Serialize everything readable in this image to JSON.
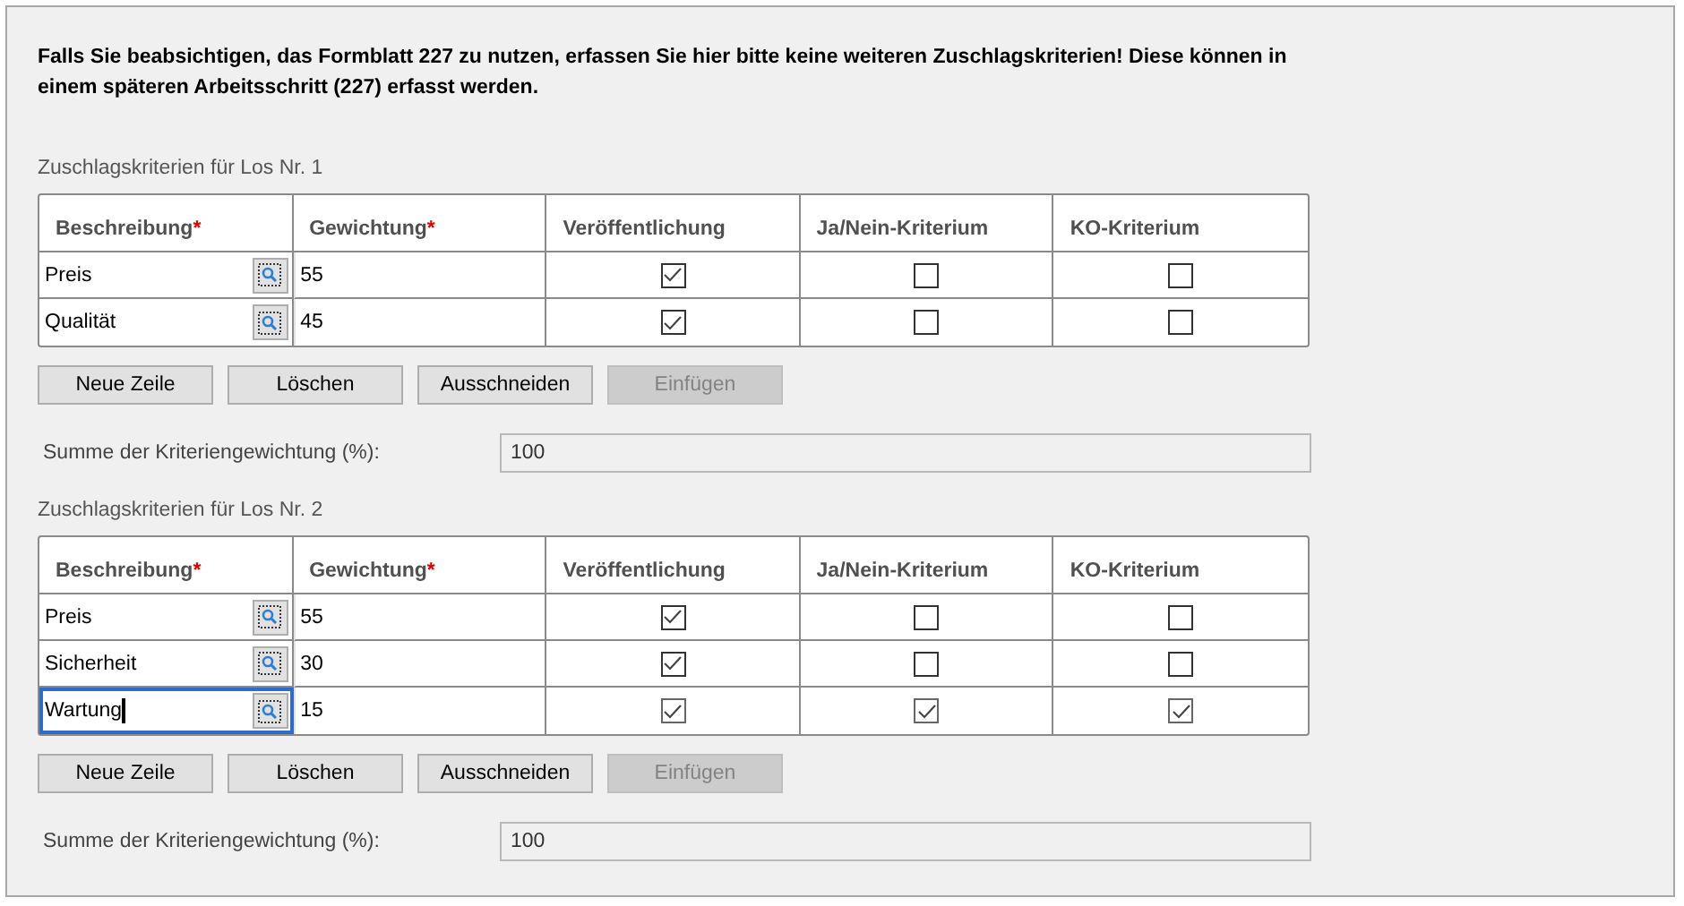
{
  "notice": "Falls Sie beabsichtigen, das Formblatt 227 zu nutzen, erfassen Sie hier bitte keine weiteren Zuschlagskriterien! Diese können in einem späteren Arbeitsschritt (227) erfasst werden.",
  "sections": [
    {
      "title": "Zuschlagskriterien für Los Nr. 1",
      "columns": [
        {
          "label": "Beschreibung",
          "marker": "*"
        },
        {
          "label": "Gewichtung",
          "marker": "*"
        },
        {
          "label": "Veröffentlichung"
        },
        {
          "label": "Ja/Nein-Kriterium"
        },
        {
          "label": "KO-Kriterium"
        }
      ],
      "rows": [
        {
          "description": "Preis",
          "weight": "55",
          "publish": true,
          "yes_no": false,
          "ko": false,
          "focused": false
        },
        {
          "description": "Qualität",
          "weight": "45",
          "publish": true,
          "yes_no": false,
          "ko": false,
          "focused": false
        }
      ],
      "buttons": [
        {
          "label": "Neue Zeile",
          "disabled": false
        },
        {
          "label": "Löschen",
          "disabled": false
        },
        {
          "label": "Ausschneiden",
          "disabled": false
        },
        {
          "label": "Einfügen",
          "disabled": true
        }
      ],
      "sum": {
        "label": "Summe der Kriteriengewichtung (%):",
        "value": "100"
      }
    },
    {
      "title": "Zuschlagskriterien für Los Nr. 2",
      "columns": [
        {
          "label": "Beschreibung",
          "marker": "*"
        },
        {
          "label": "Gewichtung",
          "marker": "*"
        },
        {
          "label": "Veröffentlichung"
        },
        {
          "label": "Ja/Nein-Kriterium"
        },
        {
          "label": "KO-Kriterium"
        }
      ],
      "rows": [
        {
          "description": "Preis",
          "weight": "55",
          "publish": true,
          "yes_no": false,
          "ko": false,
          "focused": false
        },
        {
          "description": "Sicherheit",
          "weight": "30",
          "publish": true,
          "yes_no": false,
          "ko": false,
          "focused": false
        },
        {
          "description": "Wartung",
          "weight": "15",
          "publish": true,
          "yes_no": true,
          "ko": true,
          "focused": true
        }
      ],
      "buttons": [
        {
          "label": "Neue Zeile",
          "disabled": false
        },
        {
          "label": "Löschen",
          "disabled": false
        },
        {
          "label": "Ausschneiden",
          "disabled": false
        },
        {
          "label": "Einfügen",
          "disabled": true
        }
      ],
      "sum": {
        "label": "Summe der Kriteriengewichtung (%):",
        "value": "100"
      }
    }
  ]
}
